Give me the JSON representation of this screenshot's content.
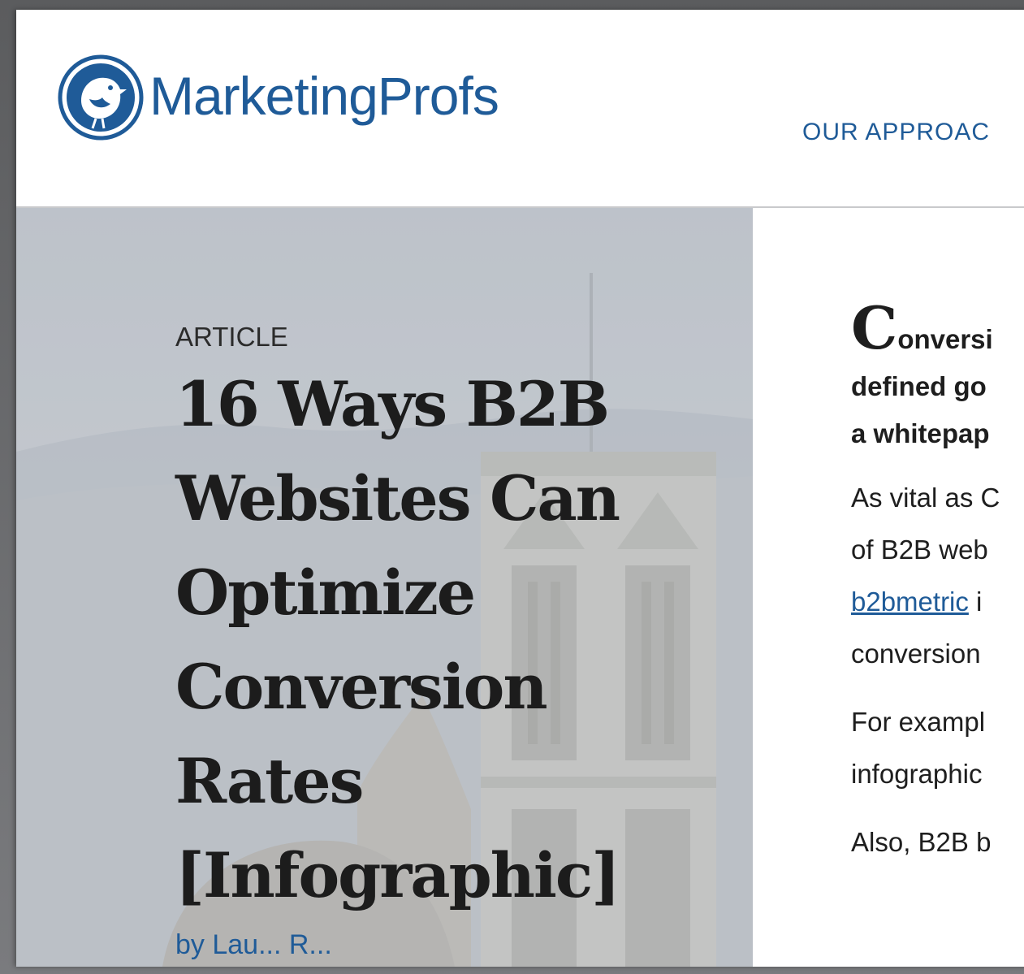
{
  "brand": {
    "name": "MarketingProfs",
    "primary_color": "#1f5b98",
    "logo_icon": "bird-circle-logo-icon"
  },
  "nav": {
    "item_1": "OUR APPROAC"
  },
  "hero": {
    "kicker": "ARTICLE",
    "title_lines": [
      "16 Ways B2B",
      "Websites Can",
      "Optimize",
      "Conversion",
      "Rates",
      "[Infographic]"
    ],
    "byline": "by Lau... R..."
  },
  "article": {
    "dropcap": "C",
    "lead_lines": [
      "onversi",
      "defined go",
      "a whitepap"
    ],
    "para1": {
      "line1": "As vital as C",
      "line2": "of B2B web",
      "link": "b2bmetric",
      "line3_rest": " i",
      "line4": "conversion"
    },
    "para2": {
      "line1": "For exampl",
      "line2": "infographic"
    },
    "para3": {
      "line1": "Also, B2B b"
    }
  }
}
